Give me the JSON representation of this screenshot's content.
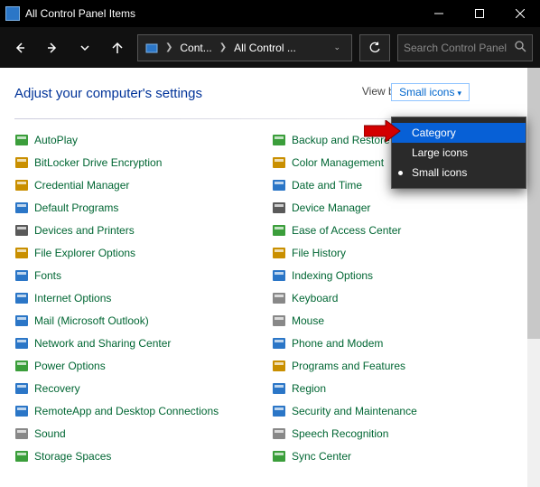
{
  "window": {
    "title": "All Control Panel Items"
  },
  "address": {
    "seg1": "Cont...",
    "seg2": "All Control ..."
  },
  "search": {
    "placeholder": "Search Control Panel"
  },
  "heading": "Adjust your computer's settings",
  "viewby": {
    "label": "View by:",
    "current": "Small icons"
  },
  "menu": {
    "category": "Category",
    "large": "Large icons",
    "small": "Small icons"
  },
  "col1": [
    "AutoPlay",
    "BitLocker Drive Encryption",
    "Credential Manager",
    "Default Programs",
    "Devices and Printers",
    "File Explorer Options",
    "Fonts",
    "Internet Options",
    "Mail (Microsoft Outlook)",
    "Network and Sharing Center",
    "Power Options",
    "Recovery",
    "RemoteApp and Desktop Connections",
    "Sound",
    "Storage Spaces"
  ],
  "col2": [
    "Backup and Restore (Windows",
    "Color Management",
    "Date and Time",
    "Device Manager",
    "Ease of Access Center",
    "File History",
    "Indexing Options",
    "Keyboard",
    "Mouse",
    "Phone and Modem",
    "Programs and Features",
    "Region",
    "Security and Maintenance",
    "Speech Recognition",
    "Sync Center"
  ],
  "icons1": [
    "autoplay-icon",
    "bitlocker-icon",
    "credential-icon",
    "default-programs-icon",
    "devices-printers-icon",
    "file-explorer-icon",
    "fonts-icon",
    "internet-options-icon",
    "mail-icon",
    "network-icon",
    "power-icon",
    "recovery-icon",
    "remoteapp-icon",
    "sound-icon",
    "storage-icon"
  ],
  "icons2": [
    "backup-icon",
    "color-icon",
    "datetime-icon",
    "device-manager-icon",
    "ease-access-icon",
    "file-history-icon",
    "indexing-icon",
    "keyboard-icon",
    "mouse-icon",
    "phone-icon",
    "programs-icon",
    "region-icon",
    "security-icon",
    "speech-icon",
    "sync-icon"
  ],
  "iconcolors1": [
    "#3b9e3b",
    "#c98f00",
    "#c98f00",
    "#2b76c7",
    "#5a5a5a",
    "#c98f00",
    "#2b76c7",
    "#2b76c7",
    "#2b76c7",
    "#2b76c7",
    "#3b9e3b",
    "#2b76c7",
    "#2b76c7",
    "#888888",
    "#3b9e3b"
  ],
  "iconcolors2": [
    "#3b9e3b",
    "#c98f00",
    "#2b76c7",
    "#5a5a5a",
    "#3b9e3b",
    "#c98f00",
    "#2b76c7",
    "#888888",
    "#888888",
    "#2b76c7",
    "#c98f00",
    "#2b76c7",
    "#2b76c7",
    "#888888",
    "#3b9e3b"
  ]
}
